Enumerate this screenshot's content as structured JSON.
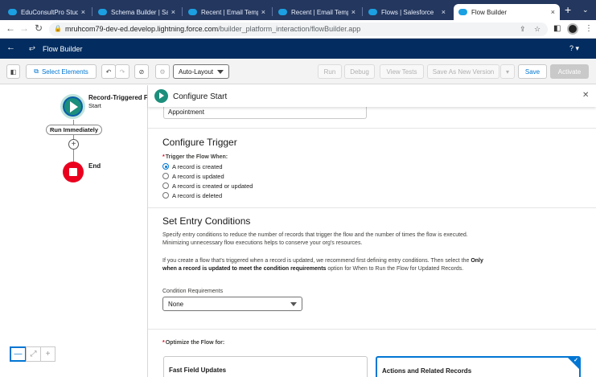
{
  "browser": {
    "tabs": [
      {
        "label": "EduConsultPro Studen",
        "active": false
      },
      {
        "label": "Schema Builder | Sales",
        "active": false
      },
      {
        "label": "Recent | Email Templat",
        "active": false
      },
      {
        "label": "Recent | Email Templat",
        "active": false
      },
      {
        "label": "Flows | Salesforce",
        "active": false
      },
      {
        "label": "Flow Builder",
        "active": true
      }
    ],
    "close_glyph": "×",
    "new_tab": "+",
    "url_host": "mruhcom79-dev-ed.develop.lightning.force.com",
    "url_path": "/builder_platform_interaction/flowBuilder.app"
  },
  "app": {
    "title": "Flow Builder",
    "help": "? ▾"
  },
  "toolbar": {
    "select_elements": "Select Elements",
    "layout_value": "Auto-Layout",
    "run": "Run",
    "debug": "Debug",
    "view_tests": "View Tests",
    "save_as_new_version": "Save As New Version",
    "save": "Save",
    "activate": "Activate"
  },
  "canvas": {
    "start_title": "Record-Triggered Fl",
    "start_subtitle": "Start",
    "run_immediately": "Run Immediately",
    "end_label": "End",
    "zoom_out": "—",
    "zoom_fit": "⤢",
    "zoom_in": "+"
  },
  "panel": {
    "title": "Configure Start",
    "object_value": "Appointment",
    "trigger": {
      "heading": "Configure Trigger",
      "label": "Trigger the Flow When:",
      "options": [
        {
          "label": "A record is created",
          "selected": true
        },
        {
          "label": "A record is updated",
          "selected": false
        },
        {
          "label": "A record is created or updated",
          "selected": false
        },
        {
          "label": "A record is deleted",
          "selected": false
        }
      ]
    },
    "entry": {
      "heading": "Set Entry Conditions",
      "para1": "Specify entry conditions to reduce the number of records that trigger the flow and the number of times the flow is executed. Minimizing unnecessary flow executions helps to conserve your org's resources.",
      "para2_before": "If you create a flow that's triggered when a record is updated, we recommend first defining entry conditions. Then select the ",
      "para2_bold": "Only when a record is updated to meet the condition requirements",
      "para2_after": " option for When to Run the Flow for Updated Records.",
      "condition_label": "Condition Requirements",
      "condition_value": "None"
    },
    "optimize": {
      "label": "Optimize the Flow for:",
      "options": [
        {
          "label": "Fast Field Updates",
          "selected": false
        },
        {
          "label": "Actions and Related Records",
          "selected": true
        }
      ]
    }
  },
  "colors": {
    "brand": "#0176d3",
    "header": "#032d60",
    "start_node": "#1c8e7c",
    "end_node": "#ea001e"
  }
}
